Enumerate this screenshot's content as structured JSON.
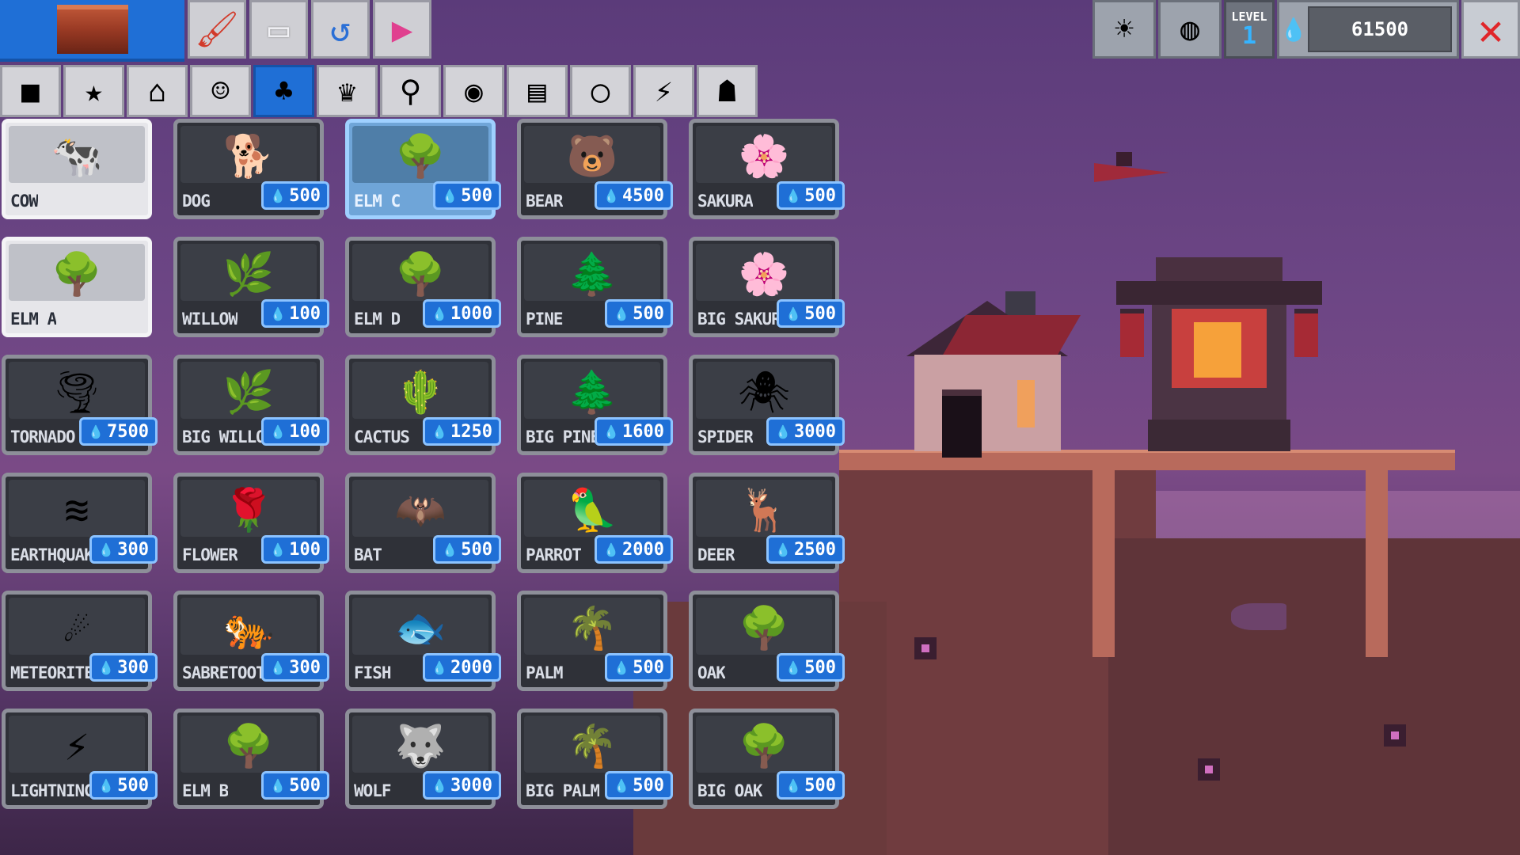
{
  "toolbar": {
    "selected_tool_icon": "dirt-block-icon",
    "tools": [
      {
        "name": "paint-brush-icon",
        "glyph": "🖌"
      },
      {
        "name": "eraser-icon",
        "glyph": "▭"
      },
      {
        "name": "undo-icon",
        "glyph": "↺"
      },
      {
        "name": "play-icon",
        "glyph": "▶"
      }
    ]
  },
  "categories": [
    {
      "name": "blocks-icon",
      "glyph": "■"
    },
    {
      "name": "star-icon",
      "glyph": "★"
    },
    {
      "name": "house-icon",
      "glyph": "⌂"
    },
    {
      "name": "person-icon",
      "glyph": "☺"
    },
    {
      "name": "nature-icon",
      "glyph": "♣",
      "active": true
    },
    {
      "name": "costume-icon",
      "glyph": "♛"
    },
    {
      "name": "joystick-icon",
      "glyph": "⚲"
    },
    {
      "name": "palette-icon",
      "glyph": "◉"
    },
    {
      "name": "book-icon",
      "glyph": "▤"
    },
    {
      "name": "lightbulb-icon",
      "glyph": "◯"
    },
    {
      "name": "laser-icon",
      "glyph": "⚡"
    },
    {
      "name": "reaper-icon",
      "glyph": "☗"
    }
  ],
  "palette": [
    {
      "label": "COW",
      "icon": "cow-icon",
      "glyph": "🐄",
      "style": "free"
    },
    {
      "label": "DOG",
      "icon": "dog-icon",
      "glyph": "🐕",
      "price": "500"
    },
    {
      "label": "ELM C",
      "icon": "elm-tree-icon",
      "glyph": "🌳",
      "price": "500",
      "style": "highlight"
    },
    {
      "label": "BEAR",
      "icon": "bear-icon",
      "glyph": "🐻",
      "price": "4500"
    },
    {
      "label": "SAKURA",
      "icon": "sakura-tree-icon",
      "glyph": "🌸",
      "price": "500"
    },
    {
      "label": "ELM A",
      "icon": "elm-tree-icon",
      "glyph": "🌳",
      "style": "free"
    },
    {
      "label": "WILLOW",
      "icon": "willow-tree-icon",
      "glyph": "🌿",
      "price": "100"
    },
    {
      "label": "ELM D",
      "icon": "elm-tree-icon",
      "glyph": "🌳",
      "price": "1000"
    },
    {
      "label": "PINE",
      "icon": "pine-tree-icon",
      "glyph": "🌲",
      "price": "500"
    },
    {
      "label": "BIG SAKURA",
      "icon": "sakura-tree-icon",
      "glyph": "🌸",
      "price": "500"
    },
    {
      "label": "TORNADO",
      "icon": "tornado-icon",
      "glyph": "🌪",
      "price": "7500"
    },
    {
      "label": "BIG WILLOW",
      "icon": "willow-tree-icon",
      "glyph": "🌿",
      "price": "100"
    },
    {
      "label": "CACTUS",
      "icon": "cactus-icon",
      "glyph": "🌵",
      "price": "1250"
    },
    {
      "label": "BIG PINE",
      "icon": "pine-tree-icon",
      "glyph": "🌲",
      "price": "1600"
    },
    {
      "label": "SPIDER",
      "icon": "spider-icon",
      "glyph": "🕷",
      "price": "3000"
    },
    {
      "label": "EARTHQUAKE",
      "icon": "earthquake-icon",
      "glyph": "≋",
      "price": "300"
    },
    {
      "label": "FLOWER",
      "icon": "flower-icon",
      "glyph": "🌹",
      "price": "100"
    },
    {
      "label": "BAT",
      "icon": "bat-icon",
      "glyph": "🦇",
      "price": "500"
    },
    {
      "label": "PARROT",
      "icon": "parrot-icon",
      "glyph": "🦜",
      "price": "2000"
    },
    {
      "label": "DEER",
      "icon": "deer-icon",
      "glyph": "🦌",
      "price": "2500"
    },
    {
      "label": "METEORITE",
      "icon": "meteorite-icon",
      "glyph": "☄",
      "price": "300"
    },
    {
      "label": "SABRETOOTH",
      "icon": "sabretooth-icon",
      "glyph": "🐅",
      "price": "300"
    },
    {
      "label": "FISH",
      "icon": "fish-icon",
      "glyph": "🐟",
      "price": "2000"
    },
    {
      "label": "PALM",
      "icon": "palm-tree-icon",
      "glyph": "🌴",
      "price": "500"
    },
    {
      "label": "OAK",
      "icon": "oak-tree-icon",
      "glyph": "🌳",
      "price": "500"
    },
    {
      "label": "LIGHTNING",
      "icon": "lightning-icon",
      "glyph": "⚡",
      "price": "500"
    },
    {
      "label": "ELM B",
      "icon": "elm-tree-icon",
      "glyph": "🌳",
      "price": "500"
    },
    {
      "label": "WOLF",
      "icon": "wolf-icon",
      "glyph": "🐺",
      "price": "3000"
    },
    {
      "label": "BIG PALM",
      "icon": "palm-tree-icon",
      "glyph": "🌴",
      "price": "500"
    },
    {
      "label": "BIG OAK",
      "icon": "oak-tree-icon",
      "glyph": "🌳",
      "price": "500"
    }
  ],
  "hud": {
    "weather_icon": "weather-icon",
    "world_icon": "globe-icon",
    "level_label": "LEVEL",
    "level_value": "1",
    "mana_icon": "water-drop-icon",
    "mana_value": "61500",
    "close_icon": "close-icon"
  },
  "colors": {
    "accent_blue": "#1f6fd6",
    "close_red": "#e0262a",
    "sky_purple": "#6d4685"
  }
}
